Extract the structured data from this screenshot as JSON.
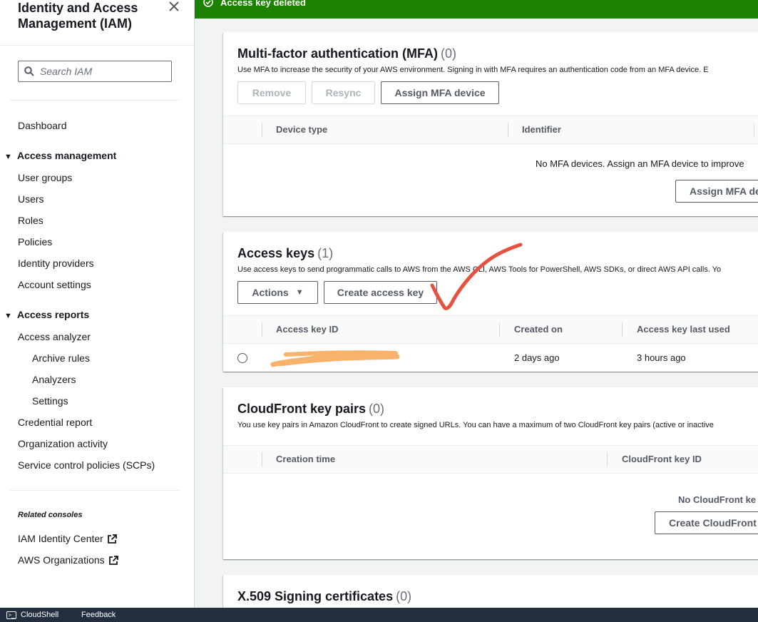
{
  "sidebar": {
    "title_line1": "Identity and Access",
    "title_line2": "Management (IAM)",
    "search_placeholder": "Search IAM",
    "dashboard": "Dashboard",
    "access_management": {
      "heading": "Access management",
      "items": [
        "User groups",
        "Users",
        "Roles",
        "Policies",
        "Identity providers",
        "Account settings"
      ]
    },
    "access_reports": {
      "heading": "Access reports",
      "analyzer": "Access analyzer",
      "analyzer_sub": [
        "Archive rules",
        "Analyzers",
        "Settings"
      ],
      "items": [
        "Credential report",
        "Organization activity",
        "Service control policies (SCPs)"
      ]
    },
    "related_label": "Related consoles",
    "related": [
      "IAM Identity Center",
      "AWS Organizations"
    ]
  },
  "flash": {
    "message": "Access key deleted",
    "color": "#1d8102"
  },
  "mfa": {
    "title": "Multi-factor authentication (MFA)",
    "count": "(0)",
    "description": "Use MFA to increase the security of your AWS environment. Signing in with MFA requires an authentication code from an MFA device. E",
    "buttons": {
      "remove": "Remove",
      "resync": "Resync",
      "assign": "Assign MFA device"
    },
    "columns": [
      "Device type",
      "Identifier"
    ],
    "empty_text": "No MFA devices. Assign an MFA device to improve",
    "empty_button": "Assign MFA de"
  },
  "access_keys": {
    "title": "Access keys",
    "count": "(1)",
    "description": "Use access keys to send programmatic calls to AWS from the AWS CLI, AWS Tools for PowerShell, AWS SDKs, or direct AWS API calls. Yo",
    "buttons": {
      "actions": "Actions",
      "create": "Create access key"
    },
    "columns": [
      "Access key ID",
      "Created on",
      "Access key last used"
    ],
    "rows": [
      {
        "created_on": "2 days ago",
        "last_used": "3 hours ago"
      }
    ]
  },
  "cloudfront": {
    "title": "CloudFront key pairs",
    "count": "(0)",
    "description": "You use key pairs in Amazon CloudFront to create signed URLs. You can have a maximum of two CloudFront key pairs (active or inactive",
    "columns": [
      "Creation time",
      "CloudFront key ID"
    ],
    "empty_text": "No CloudFront ke",
    "empty_button": "Create CloudFront"
  },
  "x509": {
    "title": "X.509 Signing certificates",
    "count": "(0)"
  },
  "bottom_bar": {
    "cloudshell": "CloudShell",
    "feedback": "Feedback"
  },
  "colors": {
    "redaction": "#f9b26b",
    "checkmark": "#e8503f"
  }
}
